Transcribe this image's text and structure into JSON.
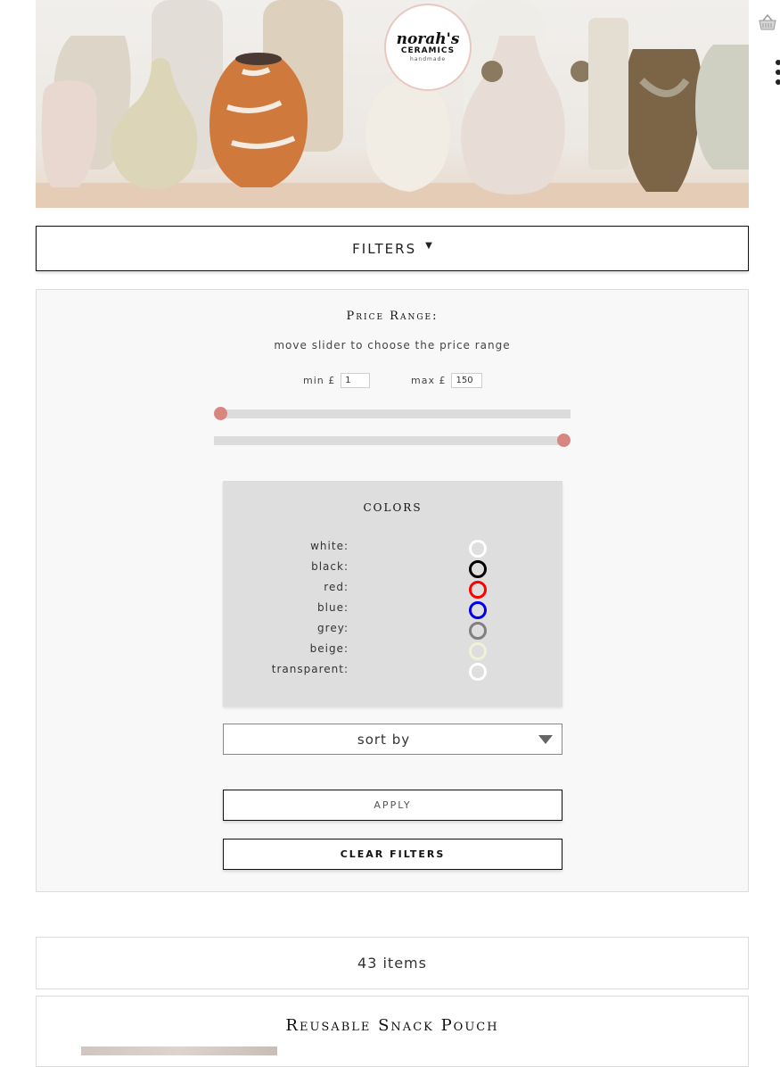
{
  "brand": {
    "logo_line1": "norah's",
    "logo_line2": "CERAMICS",
    "logo_line3": "handmade"
  },
  "header_icons": [
    "basket-icon",
    "more-icon"
  ],
  "filters": {
    "toggle_label": "FILTERS",
    "toggle_caret": "▼"
  },
  "price": {
    "title": "Price Range:",
    "hint": "move slider to choose the price range",
    "min_label": "min £",
    "min_value": "1",
    "max_label": "max £",
    "max_value": "150",
    "slider_min": 1,
    "slider_max": 150
  },
  "colors": {
    "title": "COLORS",
    "items": [
      {
        "label": "white:",
        "color": "#ffffff"
      },
      {
        "label": "black:",
        "color": "#000000"
      },
      {
        "label": "red:",
        "color": "#ff0000"
      },
      {
        "label": "blue:",
        "color": "#0000ee"
      },
      {
        "label": "grey:",
        "color": "#808080"
      },
      {
        "label": "beige:",
        "color": "#f1f1d6"
      },
      {
        "label": "transparent:",
        "color": "#ffffff"
      }
    ]
  },
  "sort": {
    "label": "sort by"
  },
  "buttons": {
    "apply": "APPLY",
    "clear": "CLEAR FILTERS"
  },
  "results": {
    "count_text": "43 items"
  },
  "product": {
    "title": "Reusable Snack Pouch"
  },
  "accent_color": "#d88680"
}
